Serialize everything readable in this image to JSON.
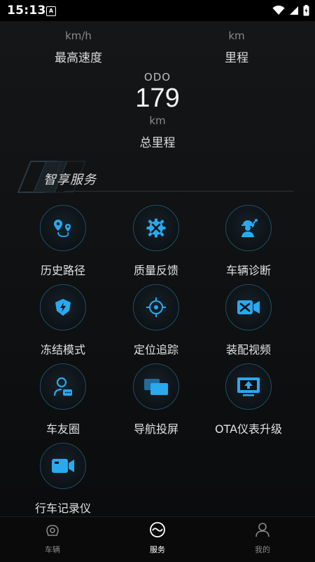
{
  "status_bar": {
    "time": "15:13",
    "notif_badge": "A"
  },
  "metrics": {
    "max_speed": {
      "unit": "km/h",
      "label": "最高速度"
    },
    "mileage": {
      "unit": "km",
      "label": "里程"
    },
    "odo": {
      "title": "ODO",
      "value": "179",
      "unit": "km",
      "label": "总里程"
    }
  },
  "section": {
    "title": "智享服务"
  },
  "services": [
    {
      "label": "历史路径",
      "icon": "route-pin-icon"
    },
    {
      "label": "质量反馈",
      "icon": "tools-gear-icon"
    },
    {
      "label": "车辆诊断",
      "icon": "mechanic-icon"
    },
    {
      "label": "冻结模式",
      "icon": "shield-bolt-icon"
    },
    {
      "label": "定位追踪",
      "icon": "crosshair-icon"
    },
    {
      "label": "装配视频",
      "icon": "tool-video-icon"
    },
    {
      "label": "车友圈",
      "icon": "user-chat-icon"
    },
    {
      "label": "导航投屏",
      "icon": "screen-cast-icon"
    },
    {
      "label": "OTA仪表升级",
      "icon": "upload-screen-icon"
    },
    {
      "label": "行车记录仪",
      "icon": "video-camera-icon"
    }
  ],
  "bottom_nav": {
    "vehicle": "车辆",
    "service": "服务",
    "mine": "我的"
  },
  "colors": {
    "accent": "#2aa9ee",
    "inactive": "#8a8a8a",
    "background": "#0e0f10"
  }
}
